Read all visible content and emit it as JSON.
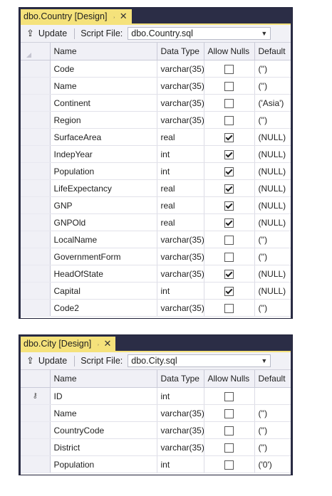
{
  "designer1": {
    "tab_title": "dbo.Country [Design]",
    "update_label": "Update",
    "script_file_label": "Script File:",
    "script_file_value": "dbo.Country.sql",
    "columns": [
      "Name",
      "Data Type",
      "Allow Nulls",
      "Default"
    ],
    "rows": [
      {
        "name": "Code",
        "type": "varchar(35)",
        "nulls": false,
        "default": "('')"
      },
      {
        "name": "Name",
        "type": "varchar(35)",
        "nulls": false,
        "default": "('')"
      },
      {
        "name": "Continent",
        "type": "varchar(35)",
        "nulls": false,
        "default": "('Asia')"
      },
      {
        "name": "Region",
        "type": "varchar(35)",
        "nulls": false,
        "default": "('')"
      },
      {
        "name": "SurfaceArea",
        "type": "real",
        "nulls": true,
        "default": "(NULL)"
      },
      {
        "name": "IndepYear",
        "type": "int",
        "nulls": true,
        "default": "(NULL)"
      },
      {
        "name": "Population",
        "type": "int",
        "nulls": true,
        "default": "(NULL)"
      },
      {
        "name": "LifeExpectancy",
        "type": "real",
        "nulls": true,
        "default": "(NULL)"
      },
      {
        "name": "GNP",
        "type": "real",
        "nulls": true,
        "default": "(NULL)"
      },
      {
        "name": "GNPOld",
        "type": "real",
        "nulls": true,
        "default": "(NULL)"
      },
      {
        "name": "LocalName",
        "type": "varchar(35)",
        "nulls": false,
        "default": "('')"
      },
      {
        "name": "GovernmentForm",
        "type": "varchar(35)",
        "nulls": false,
        "default": "('')"
      },
      {
        "name": "HeadOfState",
        "type": "varchar(35)",
        "nulls": true,
        "default": "(NULL)"
      },
      {
        "name": "Capital",
        "type": "int",
        "nulls": true,
        "default": "(NULL)"
      },
      {
        "name": "Code2",
        "type": "varchar(35)",
        "nulls": false,
        "default": "('')"
      }
    ]
  },
  "designer2": {
    "tab_title": "dbo.City [Design]",
    "update_label": "Update",
    "script_file_label": "Script File:",
    "script_file_value": "dbo.City.sql",
    "columns": [
      "Name",
      "Data Type",
      "Allow Nulls",
      "Default"
    ],
    "rows": [
      {
        "name": "ID",
        "type": "int",
        "nulls": false,
        "default": "",
        "primary_key": true
      },
      {
        "name": "Name",
        "type": "varchar(35)",
        "nulls": false,
        "default": "('')"
      },
      {
        "name": "CountryCode",
        "type": "varchar(35)",
        "nulls": false,
        "default": "('')"
      },
      {
        "name": "District",
        "type": "varchar(35)",
        "nulls": false,
        "default": "('')"
      },
      {
        "name": "Population",
        "type": "int",
        "nulls": false,
        "default": "('0')"
      }
    ]
  },
  "colors": {
    "tab_active": "#f5e27b",
    "window_frame": "#2b2d46",
    "toolbar_bg": "#f1f1f6"
  }
}
